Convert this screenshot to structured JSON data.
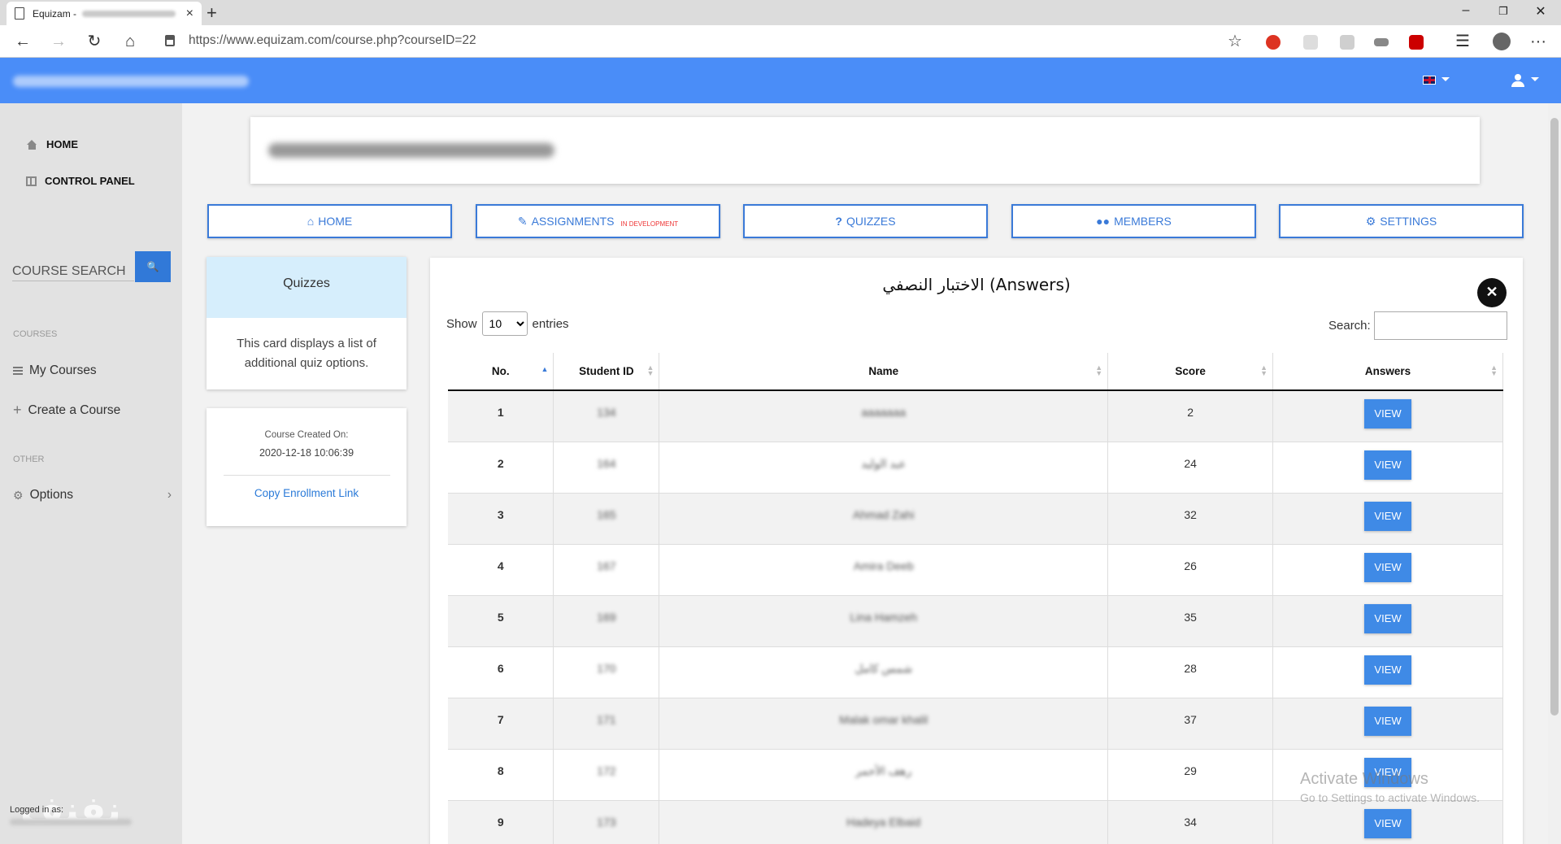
{
  "browser": {
    "tab_title": "Equizam - ",
    "tab_close": "×",
    "new_tab": "+",
    "url": "https://www.equizam.com/course.php?courseID=22",
    "win_min": "–",
    "win_max": "❐",
    "win_close": "✕",
    "back": "←",
    "forward": "→",
    "reload": "↻",
    "home": "⌂",
    "star": "☆",
    "favorites": "☰",
    "more": "···"
  },
  "sidebar": {
    "home": "HOME",
    "control_panel": "CONTROL PANEL",
    "course_search": "COURSE SEARCH",
    "courses_label": "COURSES",
    "my_courses": "My Courses",
    "create_course": "Create a Course",
    "other_label": "OTHER",
    "options": "Options",
    "logged_in_as": "Logged in as:"
  },
  "nav": {
    "home": "HOME",
    "assignments": "ASSIGNMENTS",
    "in_development": "IN DEVELOPMENT",
    "quizzes": "QUIZZES",
    "members": "MEMBERS",
    "settings": "SETTINGS"
  },
  "quizzes_card": {
    "title": "Quizzes",
    "body": "This card displays a list of additional quiz options."
  },
  "course_card": {
    "created_label": "Course Created On:",
    "created_value": "2020-12-18 10:06:39",
    "copy_link": "Copy Enrollment Link"
  },
  "table_card": {
    "title": "الاختبار النصفي (Answers)",
    "show": "Show",
    "entries_value": "10",
    "entries": "entries",
    "search": "Search:",
    "columns": [
      "No.",
      "Student ID",
      "Name",
      "Score",
      "Answers"
    ],
    "view_label": "VIEW",
    "rows": [
      {
        "no": "1",
        "id": "134",
        "name": "aaaaaaa",
        "score": "2"
      },
      {
        "no": "2",
        "id": "164",
        "name": "عبد الوليد",
        "score": "24"
      },
      {
        "no": "3",
        "id": "165",
        "name": "Ahmad Zahi",
        "score": "32"
      },
      {
        "no": "4",
        "id": "167",
        "name": "Amira Deeb",
        "score": "26"
      },
      {
        "no": "5",
        "id": "169",
        "name": "Lina Hamzeh",
        "score": "35"
      },
      {
        "no": "6",
        "id": "170",
        "name": "شمس كامل",
        "score": "28"
      },
      {
        "no": "7",
        "id": "171",
        "name": "Malak omar khalil",
        "score": "37"
      },
      {
        "no": "8",
        "id": "172",
        "name": "رهف الأحمر",
        "score": "29"
      },
      {
        "no": "9",
        "id": "173",
        "name": "Hadeya Elbaid",
        "score": "34"
      }
    ]
  },
  "watermark": {
    "activate": "Activate Windows",
    "activate_sub": "Go to Settings to activate Windows."
  },
  "colors": {
    "brand_blue": "#4a8df8",
    "button_blue": "#3f8ae6",
    "quiz_header": "#d6eefc"
  }
}
